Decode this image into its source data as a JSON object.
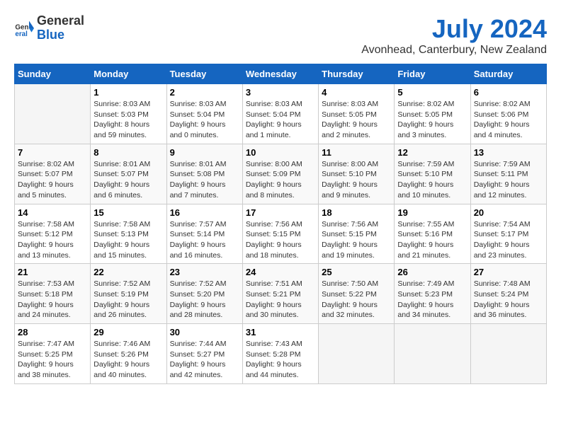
{
  "header": {
    "logo_general": "General",
    "logo_blue": "Blue",
    "title": "July 2024",
    "subtitle": "Avonhead, Canterbury, New Zealand"
  },
  "days_of_week": [
    "Sunday",
    "Monday",
    "Tuesday",
    "Wednesday",
    "Thursday",
    "Friday",
    "Saturday"
  ],
  "weeks": [
    [
      {
        "day": "",
        "info": ""
      },
      {
        "day": "1",
        "info": "Sunrise: 8:03 AM\nSunset: 5:03 PM\nDaylight: 8 hours\nand 59 minutes."
      },
      {
        "day": "2",
        "info": "Sunrise: 8:03 AM\nSunset: 5:04 PM\nDaylight: 9 hours\nand 0 minutes."
      },
      {
        "day": "3",
        "info": "Sunrise: 8:03 AM\nSunset: 5:04 PM\nDaylight: 9 hours\nand 1 minute."
      },
      {
        "day": "4",
        "info": "Sunrise: 8:03 AM\nSunset: 5:05 PM\nDaylight: 9 hours\nand 2 minutes."
      },
      {
        "day": "5",
        "info": "Sunrise: 8:02 AM\nSunset: 5:05 PM\nDaylight: 9 hours\nand 3 minutes."
      },
      {
        "day": "6",
        "info": "Sunrise: 8:02 AM\nSunset: 5:06 PM\nDaylight: 9 hours\nand 4 minutes."
      }
    ],
    [
      {
        "day": "7",
        "info": "Sunrise: 8:02 AM\nSunset: 5:07 PM\nDaylight: 9 hours\nand 5 minutes."
      },
      {
        "day": "8",
        "info": "Sunrise: 8:01 AM\nSunset: 5:07 PM\nDaylight: 9 hours\nand 6 minutes."
      },
      {
        "day": "9",
        "info": "Sunrise: 8:01 AM\nSunset: 5:08 PM\nDaylight: 9 hours\nand 7 minutes."
      },
      {
        "day": "10",
        "info": "Sunrise: 8:00 AM\nSunset: 5:09 PM\nDaylight: 9 hours\nand 8 minutes."
      },
      {
        "day": "11",
        "info": "Sunrise: 8:00 AM\nSunset: 5:10 PM\nDaylight: 9 hours\nand 9 minutes."
      },
      {
        "day": "12",
        "info": "Sunrise: 7:59 AM\nSunset: 5:10 PM\nDaylight: 9 hours\nand 10 minutes."
      },
      {
        "day": "13",
        "info": "Sunrise: 7:59 AM\nSunset: 5:11 PM\nDaylight: 9 hours\nand 12 minutes."
      }
    ],
    [
      {
        "day": "14",
        "info": "Sunrise: 7:58 AM\nSunset: 5:12 PM\nDaylight: 9 hours\nand 13 minutes."
      },
      {
        "day": "15",
        "info": "Sunrise: 7:58 AM\nSunset: 5:13 PM\nDaylight: 9 hours\nand 15 minutes."
      },
      {
        "day": "16",
        "info": "Sunrise: 7:57 AM\nSunset: 5:14 PM\nDaylight: 9 hours\nand 16 minutes."
      },
      {
        "day": "17",
        "info": "Sunrise: 7:56 AM\nSunset: 5:15 PM\nDaylight: 9 hours\nand 18 minutes."
      },
      {
        "day": "18",
        "info": "Sunrise: 7:56 AM\nSunset: 5:15 PM\nDaylight: 9 hours\nand 19 minutes."
      },
      {
        "day": "19",
        "info": "Sunrise: 7:55 AM\nSunset: 5:16 PM\nDaylight: 9 hours\nand 21 minutes."
      },
      {
        "day": "20",
        "info": "Sunrise: 7:54 AM\nSunset: 5:17 PM\nDaylight: 9 hours\nand 23 minutes."
      }
    ],
    [
      {
        "day": "21",
        "info": "Sunrise: 7:53 AM\nSunset: 5:18 PM\nDaylight: 9 hours\nand 24 minutes."
      },
      {
        "day": "22",
        "info": "Sunrise: 7:52 AM\nSunset: 5:19 PM\nDaylight: 9 hours\nand 26 minutes."
      },
      {
        "day": "23",
        "info": "Sunrise: 7:52 AM\nSunset: 5:20 PM\nDaylight: 9 hours\nand 28 minutes."
      },
      {
        "day": "24",
        "info": "Sunrise: 7:51 AM\nSunset: 5:21 PM\nDaylight: 9 hours\nand 30 minutes."
      },
      {
        "day": "25",
        "info": "Sunrise: 7:50 AM\nSunset: 5:22 PM\nDaylight: 9 hours\nand 32 minutes."
      },
      {
        "day": "26",
        "info": "Sunrise: 7:49 AM\nSunset: 5:23 PM\nDaylight: 9 hours\nand 34 minutes."
      },
      {
        "day": "27",
        "info": "Sunrise: 7:48 AM\nSunset: 5:24 PM\nDaylight: 9 hours\nand 36 minutes."
      }
    ],
    [
      {
        "day": "28",
        "info": "Sunrise: 7:47 AM\nSunset: 5:25 PM\nDaylight: 9 hours\nand 38 minutes."
      },
      {
        "day": "29",
        "info": "Sunrise: 7:46 AM\nSunset: 5:26 PM\nDaylight: 9 hours\nand 40 minutes."
      },
      {
        "day": "30",
        "info": "Sunrise: 7:44 AM\nSunset: 5:27 PM\nDaylight: 9 hours\nand 42 minutes."
      },
      {
        "day": "31",
        "info": "Sunrise: 7:43 AM\nSunset: 5:28 PM\nDaylight: 9 hours\nand 44 minutes."
      },
      {
        "day": "",
        "info": ""
      },
      {
        "day": "",
        "info": ""
      },
      {
        "day": "",
        "info": ""
      }
    ]
  ]
}
